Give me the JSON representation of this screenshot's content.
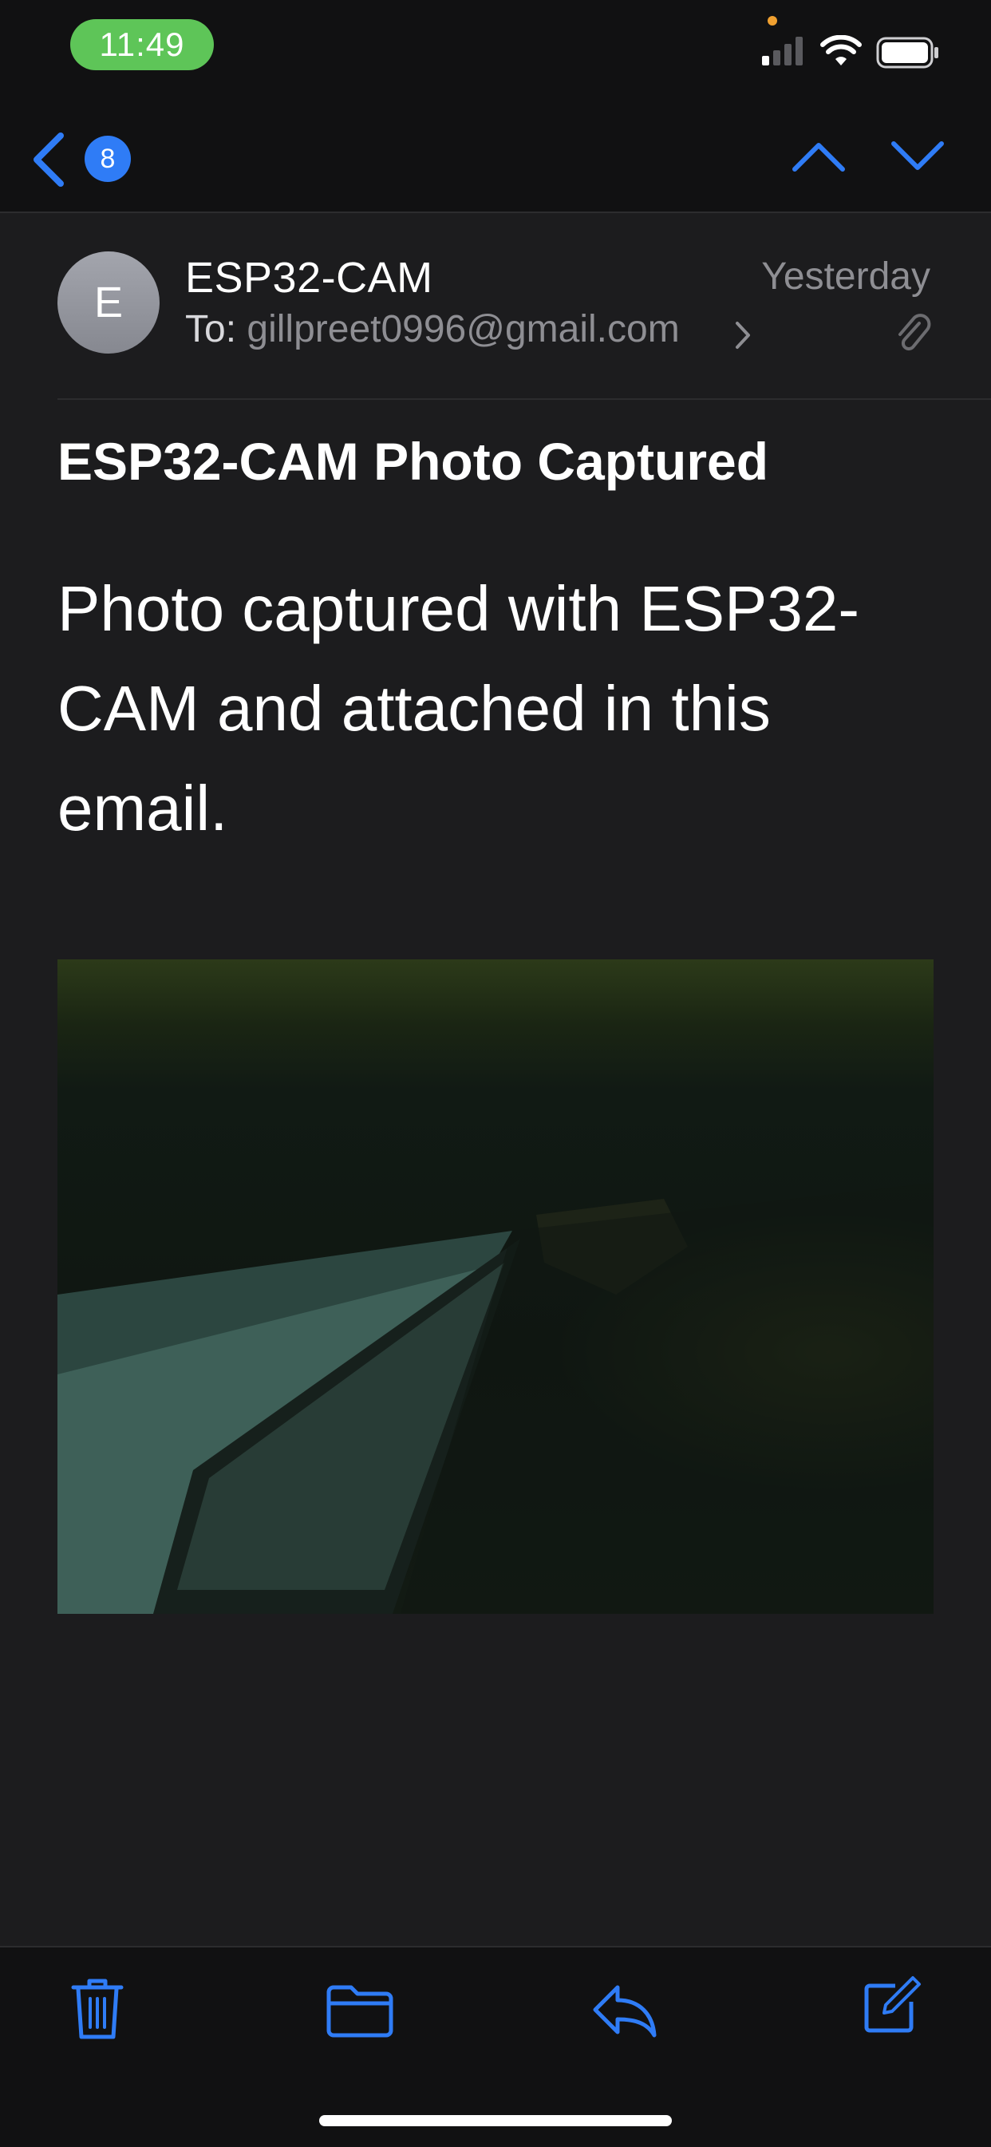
{
  "status_bar": {
    "time": "11:49"
  },
  "nav": {
    "unread_count": "8"
  },
  "message": {
    "sender_initial": "E",
    "sender_name": "ESP32-CAM",
    "to_label": "To:",
    "to_address": "gillpreet0996@gmail.com",
    "date": "Yesterday",
    "subject": "ESP32-CAM Photo Captured",
    "body": "Photo captured with ESP32-CAM and attached in this email."
  },
  "icons": {
    "back": "chevron-left-icon",
    "up": "chevron-up-icon",
    "down": "chevron-down-icon",
    "attachment": "paperclip-icon",
    "trash": "trash-icon",
    "folder": "folder-icon",
    "reply": "reply-icon",
    "compose": "compose-icon"
  },
  "colors": {
    "accent": "#2f7cf6",
    "time_pill": "#5ec558",
    "background": "#1c1c1e",
    "secondary_text": "#8e8e93"
  }
}
